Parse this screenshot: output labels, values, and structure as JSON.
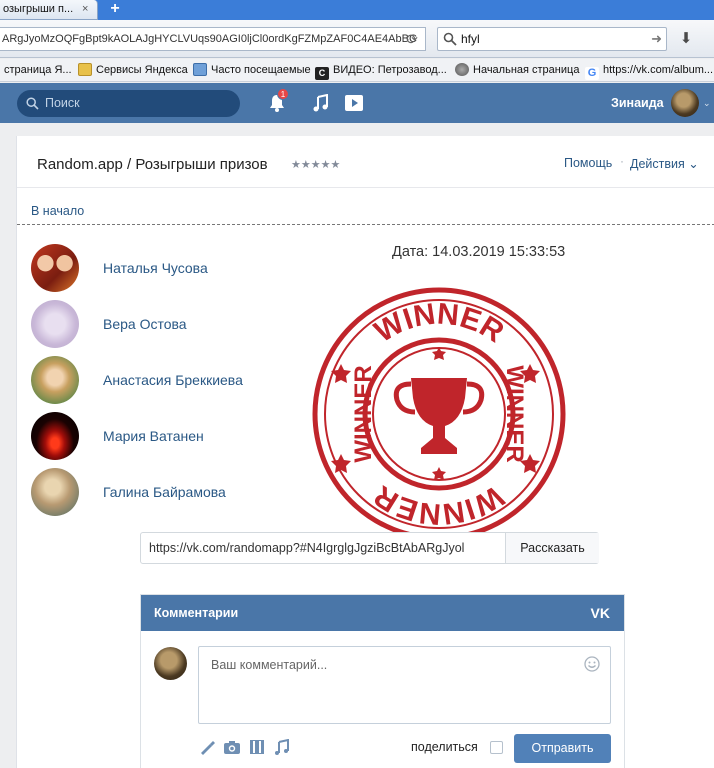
{
  "browser": {
    "tab_title": "озыгрыши п...",
    "tab_close": "×",
    "new_tab": "+",
    "url": "ARgJyoMzOQFgBpt9kAOLAJgHYCLVUqs90AGI0ljCl0ordKgFZMpZAF0C4AE4AbBC",
    "search_value": "hfyl",
    "bookmarks": [
      "страница Я...",
      "Сервисы Яндекса",
      "Часто посещаемые",
      "ВИДЕО: Петрозавод...",
      "Начальная страница",
      "https://vk.com/album..."
    ]
  },
  "vk_header": {
    "search_placeholder": "Поиск",
    "notifications_count": "1",
    "user_name": "Зинаида"
  },
  "app": {
    "title": "Random.app / Розыгрыши призов",
    "rating_stars": "★★★★★",
    "help": "Помощь",
    "actions": "Действия ⌄",
    "home_link": "В начало",
    "date": "Дата: 14.03.2019 15:33:53",
    "winners": [
      "Наталья Чусова",
      "Вера Остова",
      "Анастасия Бреккиева",
      "Мария Ватанен",
      "Галина Байрамова"
    ],
    "stamp_text": "WINNER",
    "share_url": "https://vk.com/randomapp?#N4IgrglgJgziBcBtAbARgJyol",
    "share_button": "Рассказать"
  },
  "comments": {
    "title": "Комментарии",
    "logo": "VK",
    "placeholder": "Ваш комментарий...",
    "share_label": "поделиться",
    "send_button": "Отправить"
  },
  "colors": {
    "vk_blue": "#4a76a8",
    "link": "#2a5885",
    "stamp_red": "#c0252b"
  }
}
